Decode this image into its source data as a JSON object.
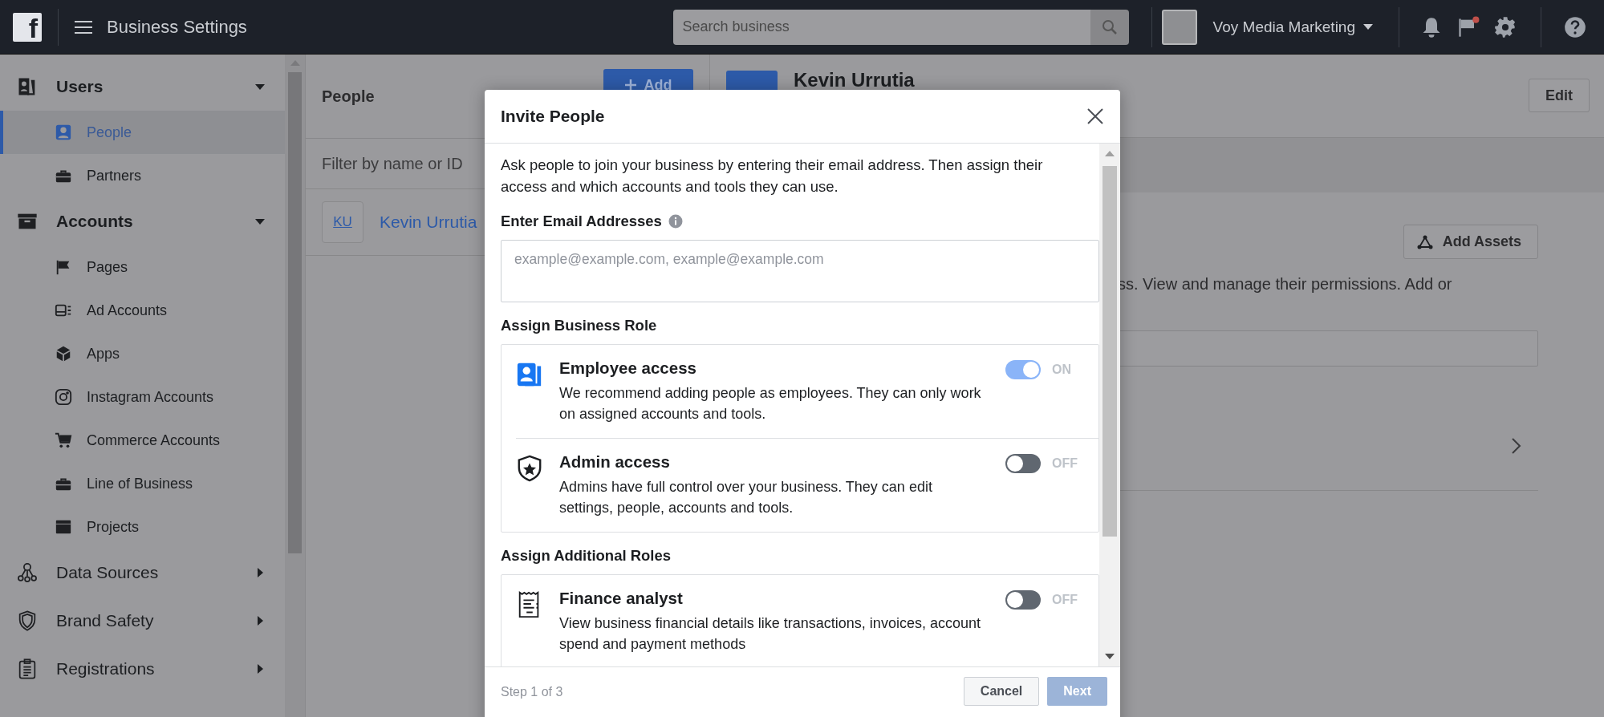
{
  "topbar": {
    "logo": "f",
    "title": "Business Settings",
    "search": {
      "placeholder": "Search business"
    },
    "account": "Voy Media Marketing"
  },
  "sidebar": {
    "sections": [
      {
        "label": "Users",
        "kind": "users",
        "expanded": true,
        "children": [
          {
            "label": "People",
            "kind": "person",
            "selected": true
          },
          {
            "label": "Partners",
            "kind": "briefcase",
            "selected": false
          }
        ]
      },
      {
        "label": "Accounts",
        "kind": "archive",
        "expanded": true,
        "children": [
          {
            "label": "Pages",
            "kind": "flag",
            "selected": false
          },
          {
            "label": "Ad Accounts",
            "kind": "adaccount",
            "selected": false
          },
          {
            "label": "Apps",
            "kind": "cube",
            "selected": false
          },
          {
            "label": "Instagram Accounts",
            "kind": "camera",
            "selected": false
          },
          {
            "label": "Commerce Accounts",
            "kind": "cart",
            "selected": false
          },
          {
            "label": "Line of Business",
            "kind": "briefcase",
            "selected": false
          },
          {
            "label": "Projects",
            "kind": "folder",
            "selected": false
          }
        ]
      },
      {
        "label": "Data Sources",
        "kind": "nodes",
        "expanded": false
      },
      {
        "label": "Brand Safety",
        "kind": "shield",
        "expanded": false
      },
      {
        "label": "Registrations",
        "kind": "clipboard",
        "expanded": false
      }
    ]
  },
  "people_panel": {
    "title": "People",
    "add_button": "Add",
    "filter": {
      "placeholder": "Filter by name or ID"
    },
    "people": [
      {
        "initials": "KU",
        "name": "Kevin Urrutia"
      }
    ]
  },
  "detail_panel": {
    "name": "Kevin Urrutia",
    "edit_button": "Edit",
    "add_assets_button": "Add Assets",
    "description": "ss. View and manage their permissions. Add or"
  },
  "modal": {
    "title": "Invite People",
    "intro": "Ask people to join your business by entering their email address. Then assign their access and which accounts and tools they can use.",
    "email_label": "Enter Email Addresses",
    "email_field": {
      "placeholder": "example@example.com, example@example.com"
    },
    "business_role_heading": "Assign Business Role",
    "business_roles": [
      {
        "kind": "badge",
        "title": "Employee access",
        "description": "We recommend adding people as employees. They can only work on assigned accounts and tools.",
        "on": true,
        "state_label": "ON"
      },
      {
        "kind": "shield",
        "title": "Admin access",
        "description": "Admins have full control over your business. They can edit settings, people, accounts and tools.",
        "on": false,
        "state_label": "OFF"
      }
    ],
    "additional_roles_heading": "Assign Additional Roles",
    "additional_roles": [
      {
        "kind": "receipt",
        "title": "Finance analyst",
        "description": "View business financial details like transactions, invoices, account spend and payment methods",
        "on": false,
        "state_label": "OFF"
      }
    ],
    "footer": {
      "step": "Step 1 of 3",
      "cancel_button": "Cancel",
      "next_button": "Next",
      "next_disabled": true
    }
  }
}
